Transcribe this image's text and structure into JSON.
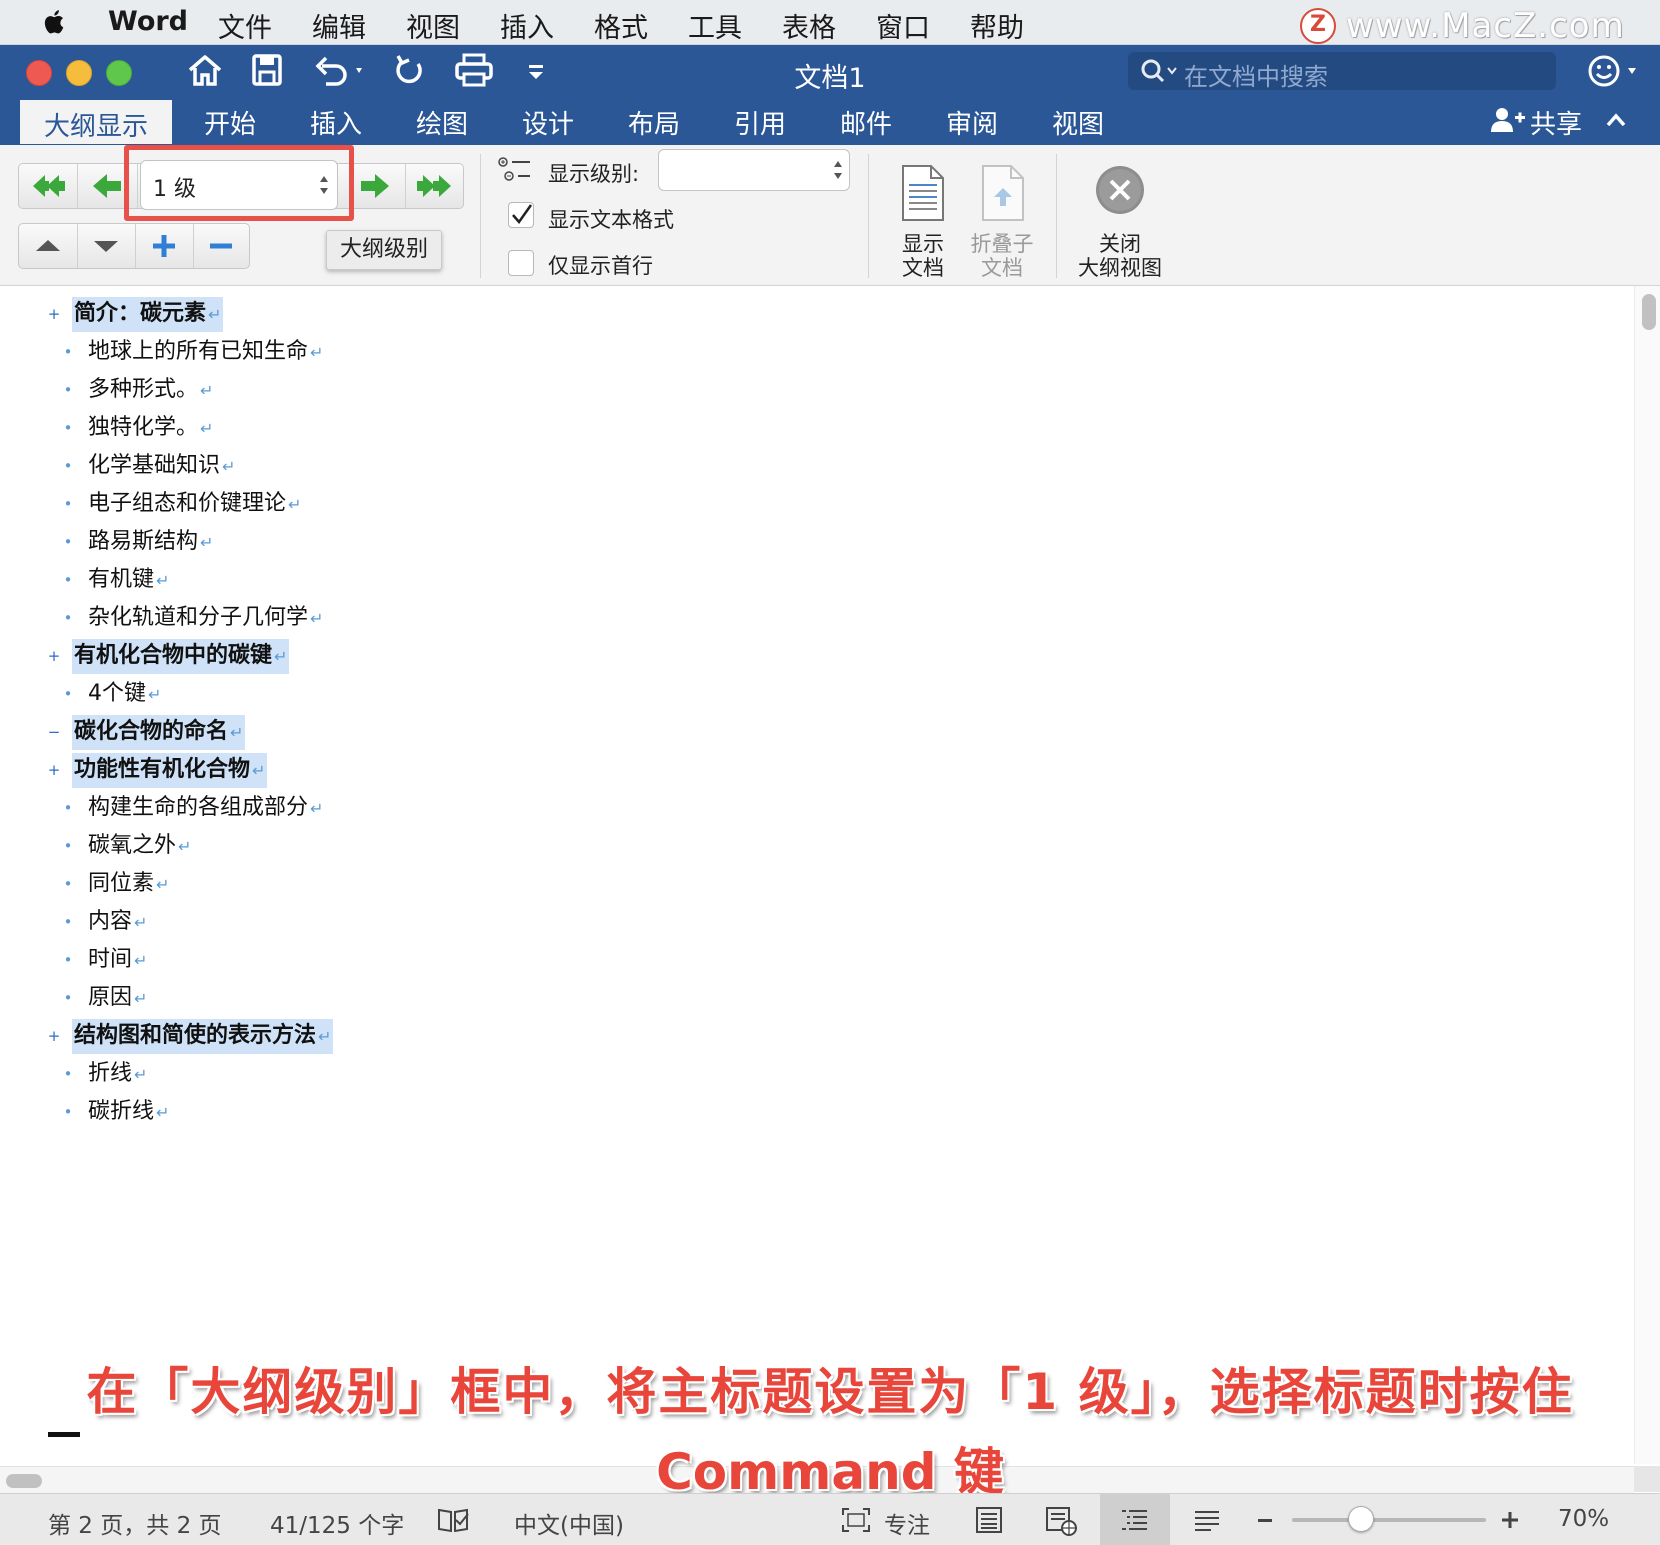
{
  "menubar": {
    "app_name": "Word",
    "items": [
      "文件",
      "编辑",
      "视图",
      "插入",
      "格式",
      "工具",
      "表格",
      "窗口",
      "帮助"
    ],
    "watermark_letter": "Z",
    "watermark_text": "www.MacZ.com"
  },
  "titlebar": {
    "document_title": "文档1",
    "search_placeholder": "在文档中搜索"
  },
  "ribbon_tabs": [
    "大纲显示",
    "开始",
    "插入",
    "绘图",
    "设计",
    "布局",
    "引用",
    "邮件",
    "审阅",
    "视图"
  ],
  "share_label": "共享",
  "outline_toolbar": {
    "level_value": "1 级",
    "level_tooltip": "大纲级别",
    "show_level_label": "显示级别:",
    "show_level_value": "",
    "show_text_formatting_label": "显示文本格式",
    "show_text_formatting_checked": true,
    "first_line_only_label": "仅显示首行",
    "first_line_only_checked": false,
    "show_document_label_1": "显示",
    "show_document_label_2": "文档",
    "collapse_subdocs_label_1": "折叠子",
    "collapse_subdocs_label_2": "文档",
    "close_outline_label_1": "关闭",
    "close_outline_label_2": "大纲视图"
  },
  "outline": [
    {
      "level": 1,
      "marker": "+",
      "text": "简介：碳元素"
    },
    {
      "level": 2,
      "marker": "•",
      "text": "地球上的所有已知生命"
    },
    {
      "level": 2,
      "marker": "•",
      "text": "多种形式。"
    },
    {
      "level": 2,
      "marker": "•",
      "text": "独特化学。"
    },
    {
      "level": 2,
      "marker": "•",
      "text": "化学基础知识"
    },
    {
      "level": 2,
      "marker": "•",
      "text": "电子组态和价键理论"
    },
    {
      "level": 2,
      "marker": "•",
      "text": "路易斯结构"
    },
    {
      "level": 2,
      "marker": "•",
      "text": "有机键"
    },
    {
      "level": 2,
      "marker": "•",
      "text": "杂化轨道和分子几何学"
    },
    {
      "level": 1,
      "marker": "+",
      "text": "有机化合物中的碳键"
    },
    {
      "level": 2,
      "marker": "•",
      "text": "4个键"
    },
    {
      "level": 1,
      "marker": "−",
      "text": "碳化合物的命名"
    },
    {
      "level": 1,
      "marker": "+",
      "text": "功能性有机化合物"
    },
    {
      "level": 2,
      "marker": "•",
      "text": "构建生命的各组成部分"
    },
    {
      "level": 2,
      "marker": "•",
      "text": "碳氧之外"
    },
    {
      "level": 2,
      "marker": "•",
      "text": "同位素"
    },
    {
      "level": 2,
      "marker": "•",
      "text": "内容"
    },
    {
      "level": 2,
      "marker": "•",
      "text": "时间"
    },
    {
      "level": 2,
      "marker": "•",
      "text": "原因"
    },
    {
      "level": 1,
      "marker": "+",
      "text": "结构图和简使的表示方法"
    },
    {
      "level": 2,
      "marker": "•",
      "text": "折线"
    },
    {
      "level": 2,
      "marker": "•",
      "text": "碳折线"
    }
  ],
  "paragraph_mark": "↵",
  "caption": {
    "line1": "在「大纲级别」框中，将主标题设置为「1 级」，选择标题时按住",
    "line2": "Command 键"
  },
  "statusbar": {
    "page_info": "第 2 页，共 2 页",
    "word_count": "41/125 个字",
    "language": "中文(中国)",
    "focus_label": "专注",
    "zoom_level": "70%",
    "zoom_fraction": 0.35
  },
  "colors": {
    "ribbon_blue": "#2b5797",
    "heading_highlight": "#cfe2f7",
    "annotation_red": "#e8514a",
    "arrow_green": "#3aa83a"
  }
}
